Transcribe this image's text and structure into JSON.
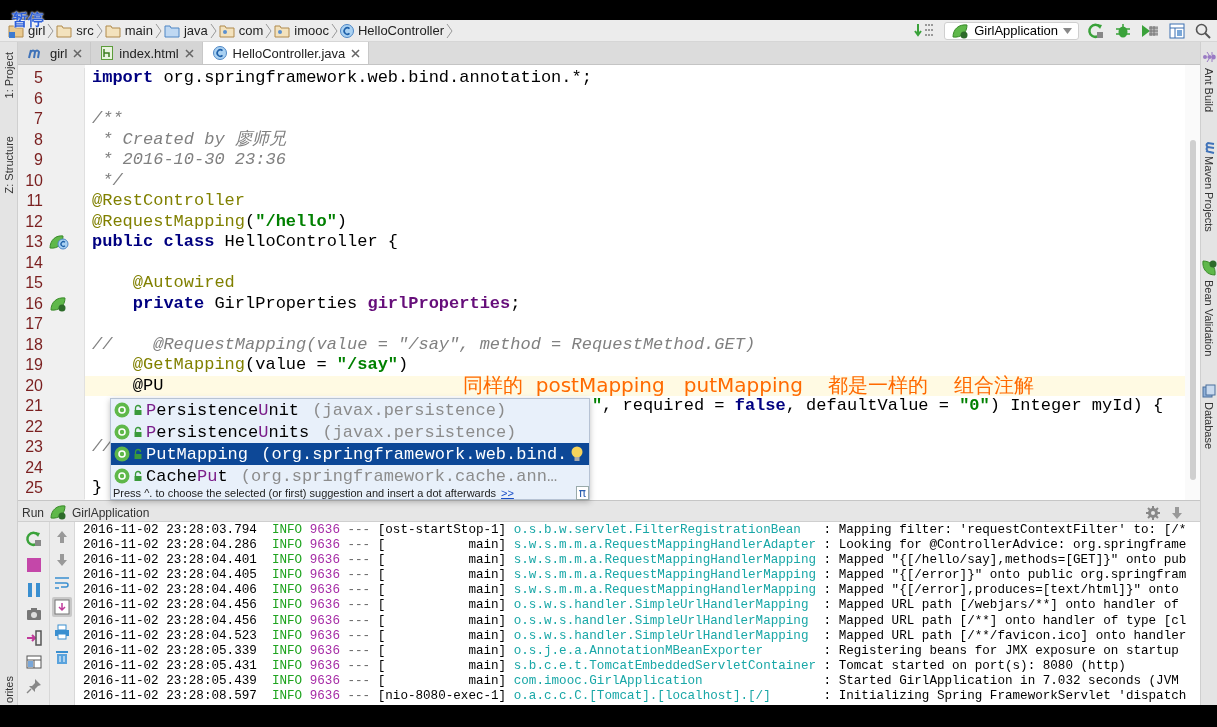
{
  "player_overlay": {
    "label": "暂停"
  },
  "breadcrumbs": [
    {
      "label": "girl",
      "kind": "module"
    },
    {
      "label": "src",
      "kind": "folder"
    },
    {
      "label": "main",
      "kind": "folder"
    },
    {
      "label": "java",
      "kind": "source-folder"
    },
    {
      "label": "com",
      "kind": "package"
    },
    {
      "label": "imooc",
      "kind": "package"
    },
    {
      "label": "HelloController",
      "kind": "class"
    }
  ],
  "run_config": {
    "label": "GirlApplication"
  },
  "left_strip": [
    {
      "label": "1: Project"
    },
    {
      "label": "Z: Structure"
    },
    {
      "label": "orites"
    }
  ],
  "right_strip": [
    {
      "label": "Ant Build",
      "kind": "ant"
    },
    {
      "label": "Maven Projects",
      "kind": "maven"
    },
    {
      "label": "Bean Validation",
      "kind": "bean"
    },
    {
      "label": "Database",
      "kind": "database"
    }
  ],
  "tabs": [
    {
      "label": "girl",
      "kind": "maven",
      "selected": false
    },
    {
      "label": "index.html",
      "kind": "html",
      "selected": false
    },
    {
      "label": "HelloController.java",
      "kind": "class",
      "selected": true
    }
  ],
  "editor": {
    "lines": [
      {
        "number": "5",
        "current": false,
        "segments": [
          {
            "kind": "keyword",
            "text": "import"
          },
          {
            "kind": "plain",
            "text": " org.springframework.web.bind.annotation.*;"
          }
        ]
      },
      {
        "number": "6",
        "current": false
      },
      {
        "number": "7",
        "current": false,
        "segments": [
          {
            "kind": "doc",
            "text": "/**"
          }
        ]
      },
      {
        "number": "8",
        "current": false,
        "segments": [
          {
            "kind": "doc",
            "text": " * Created by 廖师兄"
          }
        ]
      },
      {
        "number": "9",
        "current": false,
        "segments": [
          {
            "kind": "doc",
            "text": " * 2016-10-30 23:36"
          }
        ]
      },
      {
        "number": "10",
        "current": false,
        "segments": [
          {
            "kind": "doc",
            "text": " */"
          }
        ]
      },
      {
        "number": "11",
        "current": false,
        "segments": [
          {
            "kind": "annotation",
            "text": "@RestController"
          }
        ]
      },
      {
        "number": "12",
        "current": false,
        "segments": [
          {
            "kind": "annotation",
            "text": "@RequestMapping"
          },
          {
            "kind": "plain",
            "text": "("
          },
          {
            "kind": "string",
            "text": "\"/hello\""
          },
          {
            "kind": "plain",
            "text": ")"
          }
        ]
      },
      {
        "number": "13",
        "current": false,
        "kind": "bean-class",
        "segments": [
          {
            "kind": "keyword",
            "text": "public class"
          },
          {
            "kind": "plain",
            "text": " HelloController {"
          }
        ]
      },
      {
        "number": "14",
        "current": false
      },
      {
        "number": "15",
        "current": false,
        "segments": [
          {
            "kind": "annotation",
            "text": "    @Autowired"
          }
        ]
      },
      {
        "number": "16",
        "current": false,
        "kind": "bean",
        "segments": [
          {
            "kind": "keyword",
            "text": "    private"
          },
          {
            "kind": "plain",
            "text": " GirlProperties "
          },
          {
            "kind": "field",
            "text": "girlProperties"
          },
          {
            "kind": "plain",
            "text": ";"
          }
        ]
      },
      {
        "number": "17",
        "current": false
      },
      {
        "number": "18",
        "current": false,
        "segments": [
          {
            "kind": "comment",
            "text": "//    @RequestMapping(value = \"/say\", method = RequestMethod.GET)"
          }
        ]
      },
      {
        "number": "19",
        "current": false,
        "segments": [
          {
            "kind": "annotation",
            "text": "    @GetMapping"
          },
          {
            "kind": "plain",
            "text": "(value = "
          },
          {
            "kind": "string",
            "text": "\"/say\""
          },
          {
            "kind": "plain",
            "text": ")"
          }
        ]
      },
      {
        "number": "20",
        "current": true,
        "segments": [
          {
            "kind": "plain",
            "text": "    @PU"
          }
        ]
      },
      {
        "number": "21",
        "current": false,
        "resumes_after_popup": true,
        "segments": [
          {
            "kind": "string",
            "text": "\""
          },
          {
            "kind": "plain",
            "text": ", required = "
          },
          {
            "kind": "keyword",
            "text": "false"
          },
          {
            "kind": "plain",
            "text": ", defaultValue = "
          },
          {
            "kind": "string",
            "text": "\"0\""
          },
          {
            "kind": "plain",
            "text": ") Integer myId) {"
          }
        ]
      },
      {
        "number": "22",
        "current": false
      },
      {
        "number": "23",
        "current": false,
        "segments": [
          {
            "kind": "comment",
            "text": "//"
          }
        ]
      },
      {
        "number": "24",
        "current": false
      },
      {
        "number": "25",
        "current": false,
        "segments": [
          {
            "kind": "plain",
            "text": "}"
          }
        ]
      }
    ],
    "annotation_note": "同样的  postMapping   putMapping    都是一样的    组合注解"
  },
  "completion": {
    "items": [
      {
        "selected": false,
        "name_parts": [
          {
            "text": "P",
            "match": true
          },
          {
            "text": "ersistence",
            "match": false
          },
          {
            "text": "U",
            "match": true
          },
          {
            "text": "nit",
            "match": false
          }
        ],
        "detail": "(javax.persistence)"
      },
      {
        "selected": false,
        "name_parts": [
          {
            "text": "P",
            "match": true
          },
          {
            "text": "ersistence",
            "match": false
          },
          {
            "text": "U",
            "match": true
          },
          {
            "text": "nits",
            "match": false
          }
        ],
        "detail": "(javax.persistence)"
      },
      {
        "selected": true,
        "name_parts": [
          {
            "text": "PutMapping",
            "match": false
          }
        ],
        "detail": "(org.springframework.web.bind.",
        "bulb": true
      },
      {
        "selected": false,
        "name_parts": [
          {
            "text": "Cache",
            "match": false
          },
          {
            "text": "Pu",
            "match": true
          },
          {
            "text": "t",
            "match": false
          }
        ],
        "detail": "(org.springframework.cache.ann…"
      }
    ],
    "hint": "Press ^. to choose the selected (or first) suggestion and insert a dot afterwards",
    "hint_link": ">>",
    "pi_button": "π"
  },
  "run": {
    "title": "Run",
    "config": "GirlApplication",
    "tools_left": [
      {
        "kind": "rerun"
      },
      {
        "kind": "stop"
      },
      {
        "kind": "pause"
      },
      {
        "kind": "camera"
      },
      {
        "kind": "exit"
      },
      {
        "kind": "layout"
      },
      {
        "kind": "pin"
      }
    ],
    "tools_right": [
      {
        "kind": "up",
        "selected": false
      },
      {
        "kind": "down",
        "selected": false
      },
      {
        "kind": "wrap",
        "selected": false
      },
      {
        "kind": "scroll-end",
        "selected": true
      },
      {
        "kind": "print",
        "selected": false
      },
      {
        "kind": "trash",
        "selected": false
      }
    ],
    "log": [
      {
        "time": "2016-11-02 23:28:03.794",
        "level": "INFO",
        "pid": "9636",
        "sep": "---",
        "thread": "[ost-startStop-1]",
        "logger": "o.s.b.w.servlet.FilterRegistrationBean",
        "message": ": Mapping filter: 'requestContextFilter' to: [/*"
      },
      {
        "time": "2016-11-02 23:28:04.286",
        "level": "INFO",
        "pid": "9636",
        "sep": "---",
        "thread": "[           main]",
        "logger": "s.w.s.m.m.a.RequestMappingHandlerAdapter",
        "message": ": Looking for @ControllerAdvice: org.springframe"
      },
      {
        "time": "2016-11-02 23:28:04.401",
        "level": "INFO",
        "pid": "9636",
        "sep": "---",
        "thread": "[           main]",
        "logger": "s.w.s.m.m.a.RequestMappingHandlerMapping",
        "message": ": Mapped \"{[/hello/say],methods=[GET]}\" onto pub"
      },
      {
        "time": "2016-11-02 23:28:04.405",
        "level": "INFO",
        "pid": "9636",
        "sep": "---",
        "thread": "[           main]",
        "logger": "s.w.s.m.m.a.RequestMappingHandlerMapping",
        "message": ": Mapped \"{[/error]}\" onto public org.springfram"
      },
      {
        "time": "2016-11-02 23:28:04.406",
        "level": "INFO",
        "pid": "9636",
        "sep": "---",
        "thread": "[           main]",
        "logger": "s.w.s.m.m.a.RequestMappingHandlerMapping",
        "message": ": Mapped \"{[/error],produces=[text/html]}\" onto"
      },
      {
        "time": "2016-11-02 23:28:04.456",
        "level": "INFO",
        "pid": "9636",
        "sep": "---",
        "thread": "[           main]",
        "logger": "o.s.w.s.handler.SimpleUrlHandlerMapping",
        "message": ": Mapped URL path [/webjars/**] onto handler of"
      },
      {
        "time": "2016-11-02 23:28:04.456",
        "level": "INFO",
        "pid": "9636",
        "sep": "---",
        "thread": "[           main]",
        "logger": "o.s.w.s.handler.SimpleUrlHandlerMapping",
        "message": ": Mapped URL path [/**] onto handler of type [cl"
      },
      {
        "time": "2016-11-02 23:28:04.523",
        "level": "INFO",
        "pid": "9636",
        "sep": "---",
        "thread": "[           main]",
        "logger": "o.s.w.s.handler.SimpleUrlHandlerMapping",
        "message": ": Mapped URL path [/**/favicon.ico] onto handler"
      },
      {
        "time": "2016-11-02 23:28:05.339",
        "level": "INFO",
        "pid": "9636",
        "sep": "---",
        "thread": "[           main]",
        "logger": "o.s.j.e.a.AnnotationMBeanExporter",
        "message": ": Registering beans for JMX exposure on startup"
      },
      {
        "time": "2016-11-02 23:28:05.431",
        "level": "INFO",
        "pid": "9636",
        "sep": "---",
        "thread": "[           main]",
        "logger": "s.b.c.e.t.TomcatEmbeddedServletContainer",
        "message": ": Tomcat started on port(s): 8080 (http)"
      },
      {
        "time": "2016-11-02 23:28:05.439",
        "level": "INFO",
        "pid": "9636",
        "sep": "---",
        "thread": "[           main]",
        "logger": "com.imooc.GirlApplication",
        "message": ": Started GirlApplication in 7.032 seconds (JVM"
      },
      {
        "time": "2016-11-02 23:28:08.597",
        "level": "INFO",
        "pid": "9636",
        "sep": "---",
        "thread": "[nio-8080-exec-1]",
        "logger": "o.a.c.c.C.[Tomcat].[localhost].[/]",
        "message": ": Initializing Spring FrameworkServlet 'dispatch"
      }
    ]
  }
}
